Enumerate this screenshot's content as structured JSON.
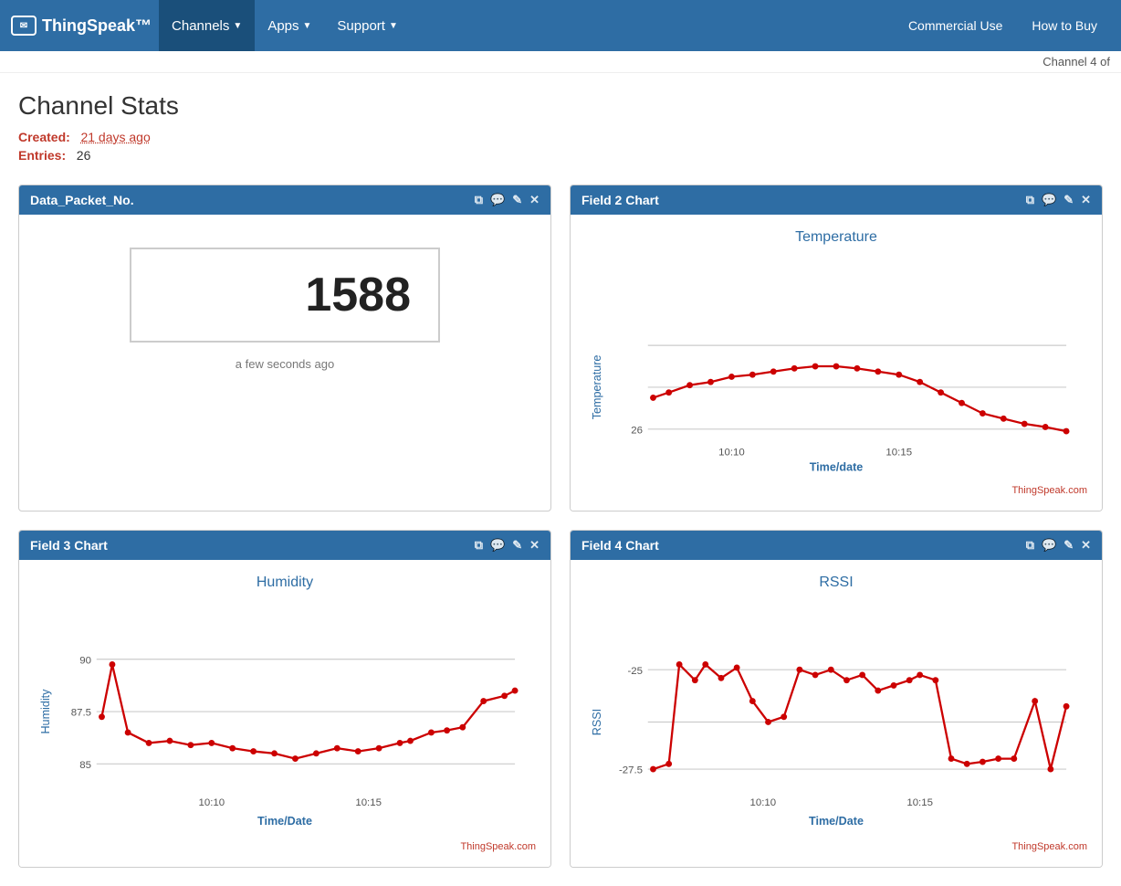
{
  "nav": {
    "logo": "ThingSpeak™",
    "logo_icon": "☐",
    "items": [
      {
        "label": "Channels",
        "active": true,
        "has_arrow": true
      },
      {
        "label": "Apps",
        "active": false,
        "has_arrow": true
      },
      {
        "label": "Support",
        "active": false,
        "has_arrow": true
      }
    ],
    "right_items": [
      {
        "label": "Commercial Use"
      },
      {
        "label": "How to Buy"
      }
    ]
  },
  "channel_bar": "Channel 4 of",
  "page": {
    "title": "Channel Stats",
    "created_label": "Created:",
    "created_value": "21 days ago",
    "entries_label": "Entries:",
    "entries_value": "26"
  },
  "widgets": [
    {
      "id": "w1",
      "title": "Data_Packet_No.",
      "type": "numeric",
      "value": "1588",
      "timestamp": "a few seconds ago"
    },
    {
      "id": "w2",
      "title": "Field 2 Chart",
      "type": "chart",
      "chart_title": "Temperature",
      "y_label": "Temperature",
      "x_label": "Time/date",
      "credit": "ThingSpeak.com"
    },
    {
      "id": "w3",
      "title": "Field 3 Chart",
      "type": "chart",
      "chart_title": "Humidity",
      "y_label": "Humidity",
      "x_label": "Time/Date",
      "credit": "ThingSpeak.com"
    },
    {
      "id": "w4",
      "title": "Field 4 Chart",
      "type": "chart",
      "chart_title": "RSSI",
      "y_label": "RSSI",
      "x_label": "Time/Date",
      "credit": "ThingSpeak.com"
    }
  ],
  "icons": {
    "external": "⧉",
    "comment": "💬",
    "edit": "✎",
    "close": "✕"
  }
}
